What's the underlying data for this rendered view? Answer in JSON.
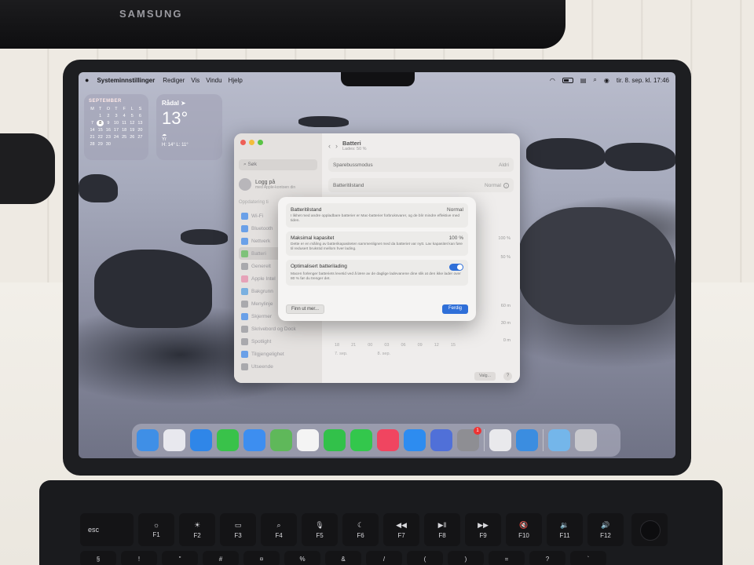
{
  "monitor": {
    "brand": "SAMSUNG"
  },
  "menubar": {
    "apple": "",
    "app": "Systeminnstillinger",
    "menus": [
      "Rediger",
      "Vis",
      "Vindu",
      "Hjelp"
    ],
    "clock": "tir. 8. sep. kl. 17:46"
  },
  "calendar": {
    "month": "SEPTEMBER",
    "days_header": [
      "M",
      "T",
      "O",
      "T",
      "F",
      "L",
      "S"
    ],
    "days": [
      "",
      "1",
      "2",
      "3",
      "4",
      "5",
      "6",
      "7",
      "8",
      "9",
      "10",
      "11",
      "12",
      "13",
      "14",
      "15",
      "16",
      "17",
      "18",
      "19",
      "20",
      "21",
      "22",
      "23",
      "24",
      "25",
      "26",
      "27",
      "28",
      "29",
      "30",
      "",
      "",
      "",
      ""
    ],
    "today": "8"
  },
  "weather": {
    "city": "Rådal",
    "temp": "13°",
    "condition": "Yr",
    "range": "H: 14° L: 11°"
  },
  "settings": {
    "search_placeholder": "Søk",
    "login_title": "Logg på",
    "login_sub": "med Apple-kontoen din",
    "section": "Oppdatering ti",
    "sidebar": [
      {
        "label": "Wi-Fi",
        "color": "#6aa0e8"
      },
      {
        "label": "Bluetooth",
        "color": "#6aa0e8"
      },
      {
        "label": "Nettverk",
        "color": "#6aa0e8"
      },
      {
        "label": "Batteri",
        "color": "#7fc27a",
        "selected": true
      },
      {
        "label": "Generelt",
        "color": "#a9a9ad"
      },
      {
        "label": "Apple Intel",
        "color": "#e6a2b8"
      },
      {
        "label": "Bakgrunn",
        "color": "#7ab0e0"
      },
      {
        "label": "Menylinje",
        "color": "#a9a9ad"
      },
      {
        "label": "Skjermer",
        "color": "#6aa0e8"
      },
      {
        "label": "Skrivebord og Dock",
        "color": "#a9a9ad"
      },
      {
        "label": "Spotlight",
        "color": "#a9a9ad"
      },
      {
        "label": "Tilgjengelighet",
        "color": "#6aa0e8"
      },
      {
        "label": "Utseende",
        "color": "#a9a9ad"
      }
    ],
    "title": "Batteri",
    "subtitle": "Lades: 50 %",
    "rows": [
      {
        "label": "Sparebussmodus",
        "value": "Aldri"
      },
      {
        "label": "Batteritilstand",
        "value": "Normal"
      }
    ],
    "chart_pct": [
      "100 %",
      "50 %"
    ],
    "chart_min": [
      "60 m",
      "30 m",
      "0 m"
    ],
    "hours": [
      "18",
      "21",
      "00",
      "03",
      "06",
      "09",
      "12",
      "15"
    ],
    "dates": [
      "7. sep.",
      "8. sep."
    ],
    "options_button": "Valg...",
    "help": "?"
  },
  "sheet": {
    "sections": [
      {
        "title": "Batteritilstand",
        "value": "Normal",
        "desc": "I likhet med andre oppladbare batterier er Mac-batterier forbruksvarer, og de blir mindre effektive med tiden."
      },
      {
        "title": "Maksimal kapasitet",
        "value": "100 %",
        "desc": "Dette er en måling av batterikapasiteten sammenlignet med da batteriet var nytt. Lav kapasitet kan føre til redusert brukstid mellom hver lading."
      },
      {
        "title": "Optimalisert batterilading",
        "value": "",
        "desc": "Macen forlenger batteriets levetid ved å lære av de daglige ladevanene dine slik at den ikke lader over 80 % før du trenger det."
      }
    ],
    "learn_more": "Finn ut mer...",
    "done": "Ferdig"
  },
  "dock": {
    "apps": [
      {
        "name": "finder-icon",
        "color": "#3f8fe6"
      },
      {
        "name": "launchpad-icon",
        "color": "#e8e8ee"
      },
      {
        "name": "safari-icon",
        "color": "#2f86e8"
      },
      {
        "name": "messages-icon",
        "color": "#39c24a"
      },
      {
        "name": "mail-icon",
        "color": "#3d8ef0"
      },
      {
        "name": "maps-icon",
        "color": "#5fb85a"
      },
      {
        "name": "photos-icon",
        "color": "#f4f4f4"
      },
      {
        "name": "facetime-icon",
        "color": "#32c14a"
      },
      {
        "name": "phone-icon",
        "color": "#33c74c"
      },
      {
        "name": "music-icon",
        "color": "#f04560"
      },
      {
        "name": "appstore-icon",
        "color": "#2d8cf0"
      },
      {
        "name": "iphone-mirroring-icon",
        "color": "#5070d8"
      },
      {
        "name": "system-settings-icon",
        "color": "#8e8e93",
        "badge": "1"
      },
      {
        "name": "preview-icon",
        "color": "#e9e9ec"
      },
      {
        "name": "weather-icon",
        "color": "#3b8de0"
      },
      {
        "name": "downloads-folder-icon",
        "color": "#74b6ea"
      },
      {
        "name": "trash-icon",
        "color": "#c9c9ce"
      }
    ]
  },
  "keyboard": {
    "keys": [
      {
        "label": "esc",
        "icon": ""
      },
      {
        "label": "F1",
        "icon": "☼"
      },
      {
        "label": "F2",
        "icon": "☀"
      },
      {
        "label": "F3",
        "icon": "▭"
      },
      {
        "label": "F4",
        "icon": "⌕"
      },
      {
        "label": "F5",
        "icon": "🎙"
      },
      {
        "label": "F6",
        "icon": "☾"
      },
      {
        "label": "F7",
        "icon": "◀◀"
      },
      {
        "label": "F8",
        "icon": "▶‖"
      },
      {
        "label": "F9",
        "icon": "▶▶"
      },
      {
        "label": "F10",
        "icon": "🔇"
      },
      {
        "label": "F11",
        "icon": "🔉"
      },
      {
        "label": "F12",
        "icon": "🔊"
      }
    ],
    "row2": [
      "§",
      "!",
      "\"",
      "#",
      "¤",
      "%",
      "&",
      "/",
      "(",
      ")",
      "=",
      "?",
      "`"
    ]
  }
}
